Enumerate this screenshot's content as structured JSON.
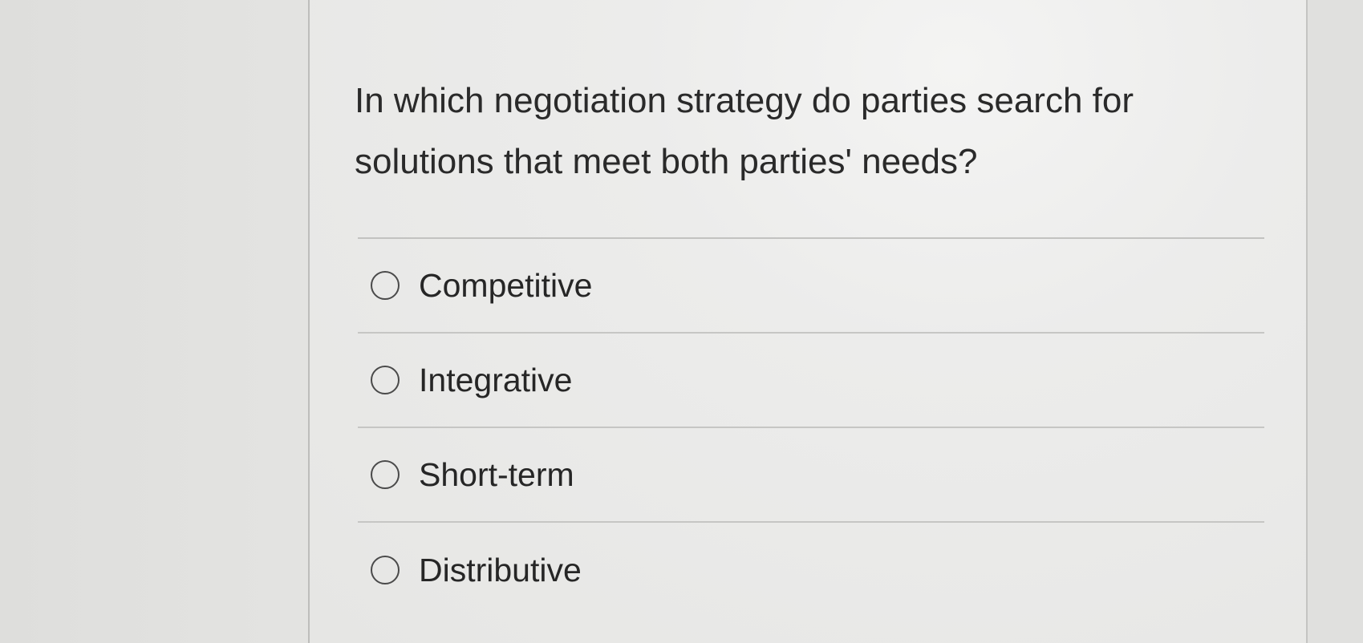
{
  "question": {
    "text": "In which negotiation strategy do parties search for solutions that meet both parties' needs?"
  },
  "options": [
    {
      "label": "Competitive",
      "selected": false
    },
    {
      "label": "Integrative",
      "selected": false
    },
    {
      "label": "Short-term",
      "selected": false
    },
    {
      "label": "Distributive",
      "selected": false
    }
  ]
}
